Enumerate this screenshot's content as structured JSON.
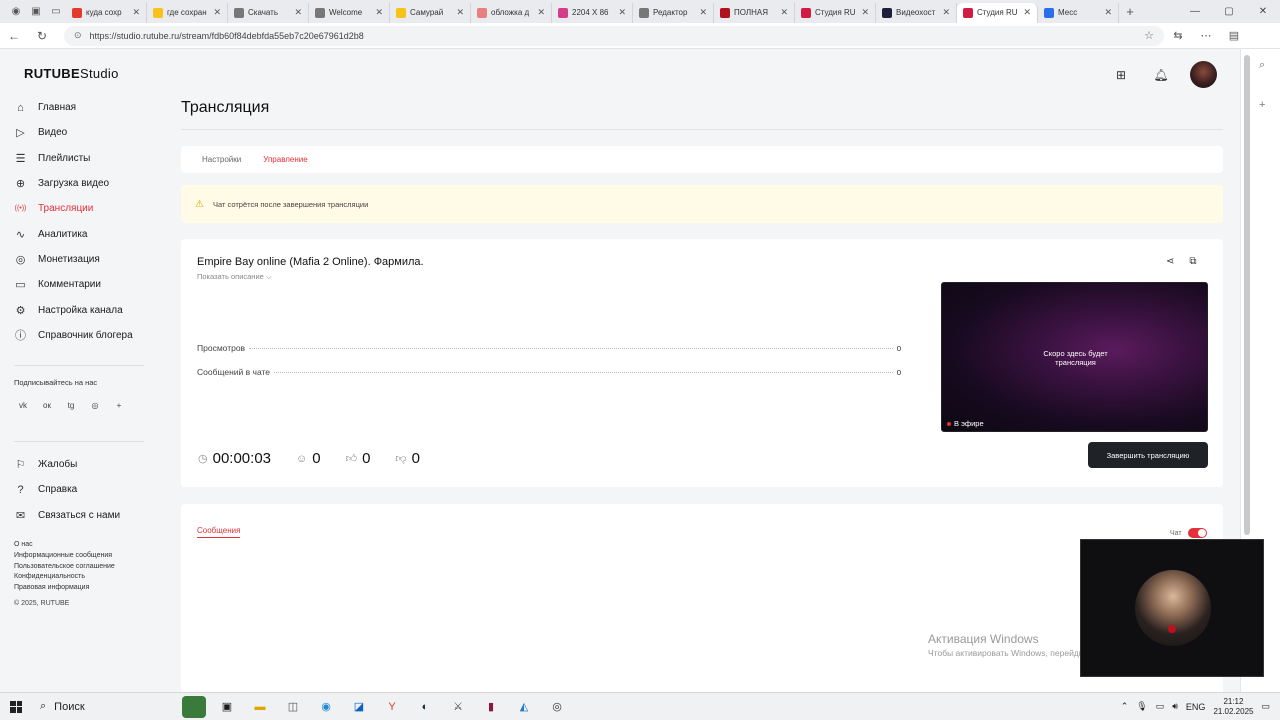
{
  "browser": {
    "tabs": [
      {
        "title": "куда сохр",
        "color": "#e23b2e"
      },
      {
        "title": "где сохран",
        "color": "#f6c21b"
      },
      {
        "title": "Скачать",
        "color": "#777777"
      },
      {
        "title": "Welcome",
        "color": "#777777"
      },
      {
        "title": "Самурай",
        "color": "#f6c21b"
      },
      {
        "title": "обложка д",
        "color": "#e88080"
      },
      {
        "title": "2204 Х 86",
        "color": "#d43d8a"
      },
      {
        "title": "Редактор",
        "color": "#777777"
      },
      {
        "title": "ПОЛНАЯ",
        "color": "#b0131d"
      },
      {
        "title": "Студия RU",
        "color": "#d01c44"
      },
      {
        "title": "Видеохост",
        "color": "#1e1e3c"
      },
      {
        "title": "Студия RU",
        "color": "#d01c44"
      },
      {
        "title": "Месс",
        "color": "#2a6ee8"
      }
    ],
    "active_tab_index": 11,
    "url": "https://studio.rutube.ru/stream/fdb60f84debfda55eb7c20e67961d2b8"
  },
  "app": {
    "logo_brand": "RUTUBE",
    "logo_product": "Studio"
  },
  "sidebar": {
    "items": [
      {
        "label": "Главная",
        "icon": "home-icon",
        "glyph": "⌂"
      },
      {
        "label": "Видео",
        "icon": "video-icon",
        "glyph": "▷"
      },
      {
        "label": "Плейлисты",
        "icon": "playlist-icon",
        "glyph": "☰"
      },
      {
        "label": "Загрузка видео",
        "icon": "upload-icon",
        "glyph": "⊕"
      },
      {
        "label": "Трансляции",
        "icon": "broadcast-icon",
        "glyph": "((•))"
      },
      {
        "label": "Аналитика",
        "icon": "analytics-icon",
        "glyph": "∿"
      },
      {
        "label": "Монетизация",
        "icon": "monetization-icon",
        "glyph": "◎"
      },
      {
        "label": "Комментарии",
        "icon": "comments-icon",
        "glyph": "▭"
      },
      {
        "label": "Настройка канала",
        "icon": "settings-icon",
        "glyph": "⚙"
      },
      {
        "label": "Справочник блогера",
        "icon": "help-icon",
        "glyph": "ⓘ"
      }
    ],
    "active_index": 4,
    "subscribe_label": "Подписывайтесь на нас",
    "socials": [
      "vk",
      "ок",
      "tg",
      "◎",
      "+"
    ],
    "secondary_items": [
      {
        "label": "Жалобы",
        "icon": "flag-icon",
        "glyph": "⚐"
      },
      {
        "label": "Справка",
        "icon": "help-circle-icon",
        "glyph": "?"
      },
      {
        "label": "Связаться с нами",
        "icon": "mail-icon",
        "glyph": "✉"
      }
    ],
    "footer_links": [
      "О нас",
      "Информационные сообщения",
      "Пользовательское соглашение",
      "Конфиденциальность",
      "Правовая информация"
    ],
    "copyright": "© 2025, RUTUBE"
  },
  "main": {
    "page_title": "Трансляция",
    "tabs": [
      {
        "label": "Настройки"
      },
      {
        "label": "Управление"
      }
    ],
    "active_tab_index": 1,
    "warning_text": "Чат сотрётся после завершения трансляции",
    "stream": {
      "title": "Empire Bay online (Mafia 2 Online). Фармила.",
      "show_description": "Показать описание ⌵",
      "stats": [
        {
          "label": "Просмотров",
          "value": "0"
        },
        {
          "label": "Сообщений в чате",
          "value": "0"
        }
      ],
      "preview_text_line1": "Скоро здесь будет",
      "preview_text_line2": "трансляция",
      "live_label": "В эфире",
      "duration": "00:00:03",
      "viewers": "0",
      "likes": "0",
      "dislikes": "0",
      "end_button": "Завершить трансляцию"
    },
    "chat": {
      "messages_tab": "Сообщения",
      "chat_toggle_label": "Чат",
      "chat_enabled": true
    }
  },
  "overlay": {
    "activation_title": "Активация Windows",
    "activation_text": "Чтобы активировать Windows, перейдите в раздел \"Параметры\"."
  },
  "taskbar": {
    "search_label": "Поиск",
    "lang": "ENG",
    "time": "21:12",
    "date": "21.02.2025"
  }
}
